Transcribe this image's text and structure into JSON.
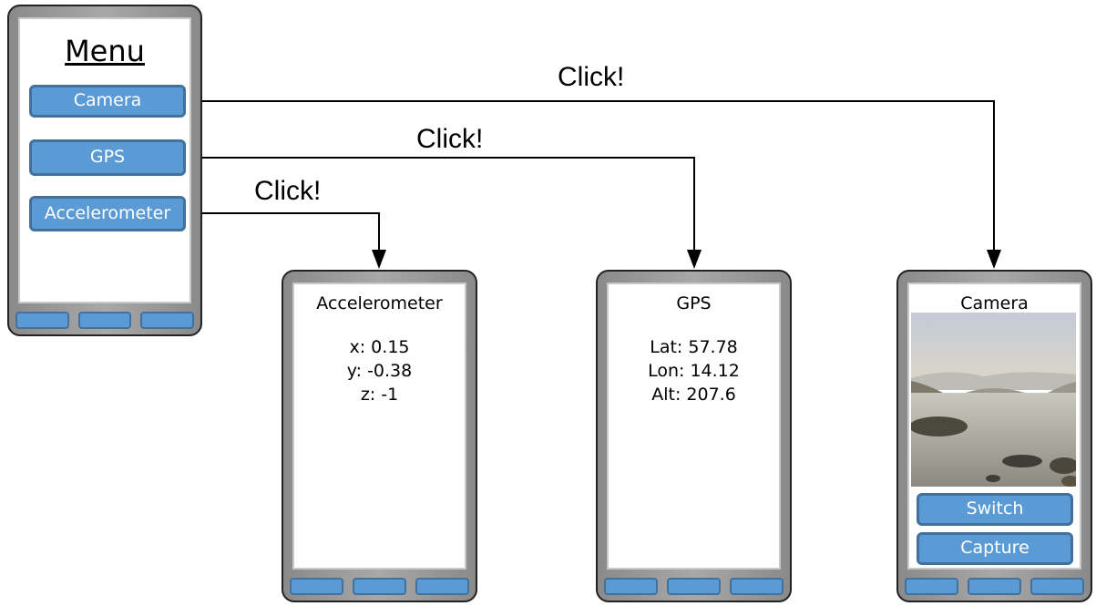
{
  "menu": {
    "title": "Menu",
    "buttons": [
      "Camera",
      "GPS",
      "Accelerometer"
    ]
  },
  "arrows": {
    "label": "Click!"
  },
  "accelerometer": {
    "title": "Accelerometer",
    "lines": [
      "x: 0.15",
      "y: -0.38",
      "z: -1"
    ]
  },
  "gps": {
    "title": "GPS",
    "lines": [
      "Lat: 57.78",
      "Lon: 14.12",
      "Alt: 207.6"
    ]
  },
  "camera": {
    "title": "Camera",
    "buttons": [
      "Switch",
      "Capture"
    ]
  },
  "colors": {
    "button": "#5b9bd5",
    "button_border": "#41719c",
    "phone_body": "#999999"
  }
}
